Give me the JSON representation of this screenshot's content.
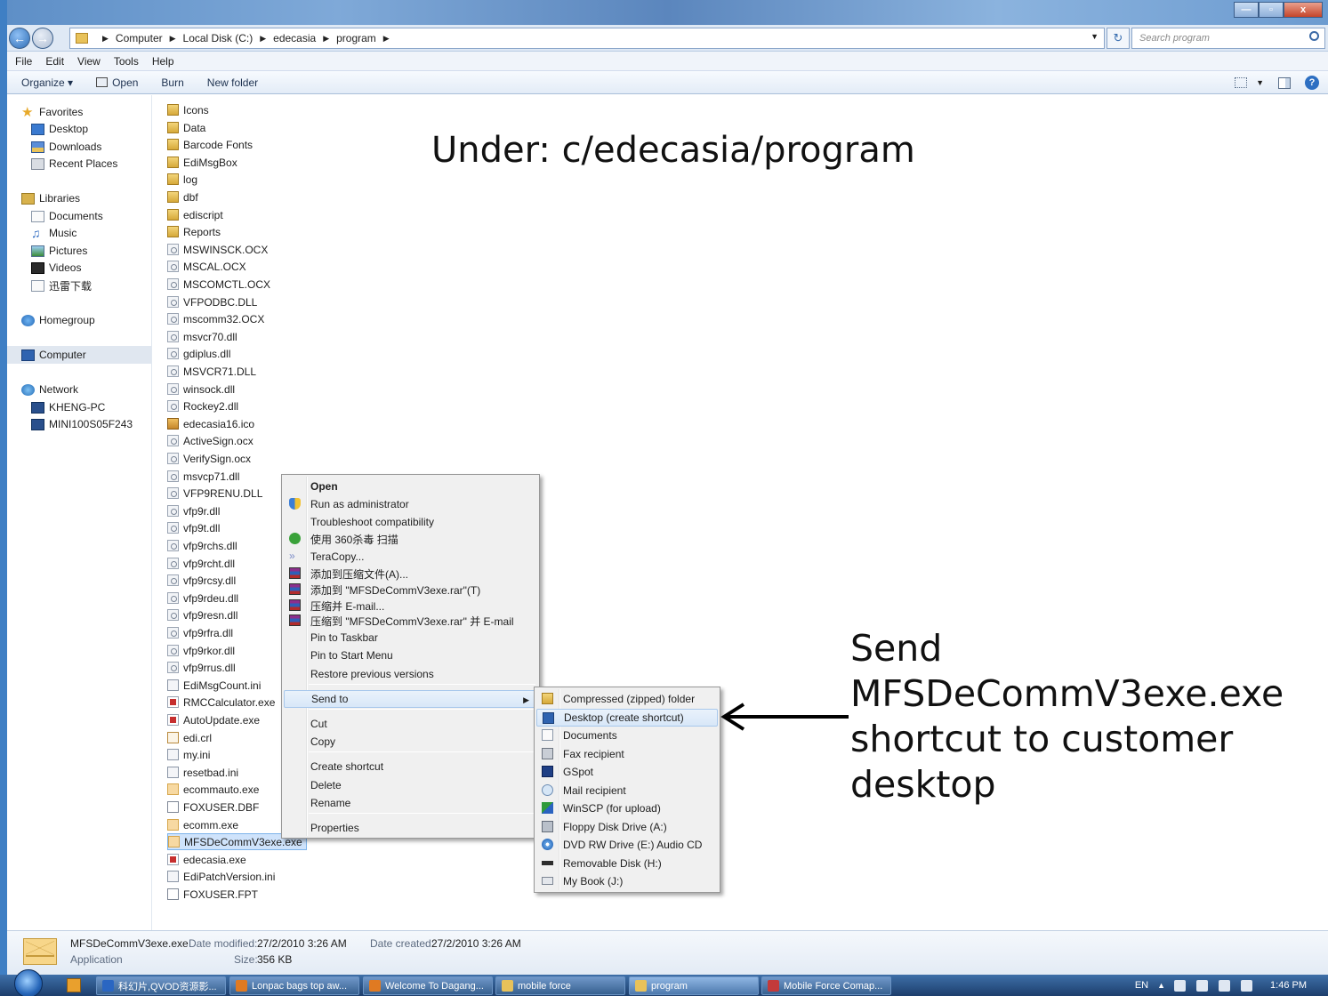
{
  "window": {
    "buttons": {
      "minimize": "—",
      "maximize": "▫",
      "close": "x"
    }
  },
  "address": {
    "crumbs": [
      "Computer",
      "Local Disk (C:)",
      "edecasia",
      "program"
    ],
    "search_placeholder": "Search program"
  },
  "menubar": [
    "File",
    "Edit",
    "View",
    "Tools",
    "Help"
  ],
  "toolbar": {
    "organize": "Organize ▾",
    "open": "Open",
    "burn": "Burn",
    "new_folder": "New folder"
  },
  "nav": {
    "favorites": "Favorites",
    "desktop": "Desktop",
    "downloads": "Downloads",
    "recent": "Recent Places",
    "libraries": "Libraries",
    "documents": "Documents",
    "music": "Music",
    "pictures": "Pictures",
    "videos": "Videos",
    "xunlei": "迅雷下载",
    "homegroup": "Homegroup",
    "computer": "Computer",
    "network": "Network",
    "kheng_pc": "KHENG-PC",
    "mini": "MINI100S05F243"
  },
  "files": [
    {
      "name": "Icons",
      "type": "folder"
    },
    {
      "name": "Data",
      "type": "folder"
    },
    {
      "name": "Barcode Fonts",
      "type": "folder"
    },
    {
      "name": "EdiMsgBox",
      "type": "folder"
    },
    {
      "name": "log",
      "type": "folder"
    },
    {
      "name": "dbf",
      "type": "folder"
    },
    {
      "name": "ediscript",
      "type": "folder"
    },
    {
      "name": "Reports",
      "type": "folder"
    },
    {
      "name": "MSWINSCK.OCX",
      "type": "dll"
    },
    {
      "name": "MSCAL.OCX",
      "type": "dll"
    },
    {
      "name": "MSCOMCTL.OCX",
      "type": "dll"
    },
    {
      "name": "VFPODBC.DLL",
      "type": "dll"
    },
    {
      "name": "mscomm32.OCX",
      "type": "dll"
    },
    {
      "name": "msvcr70.dll",
      "type": "dll"
    },
    {
      "name": "gdiplus.dll",
      "type": "dll"
    },
    {
      "name": "MSVCR71.DLL",
      "type": "dll"
    },
    {
      "name": "winsock.dll",
      "type": "dll"
    },
    {
      "name": "Rockey2.dll",
      "type": "dll"
    },
    {
      "name": "edecasia16.ico",
      "type": "ico"
    },
    {
      "name": "ActiveSign.ocx",
      "type": "dll"
    },
    {
      "name": "VerifySign.ocx",
      "type": "dll"
    },
    {
      "name": "msvcp71.dll",
      "type": "dll"
    },
    {
      "name": "VFP9RENU.DLL",
      "type": "dll"
    },
    {
      "name": "vfp9r.dll",
      "type": "dll"
    },
    {
      "name": "vfp9t.dll",
      "type": "dll"
    },
    {
      "name": "vfp9rchs.dll",
      "type": "dll"
    },
    {
      "name": "vfp9rcht.dll",
      "type": "dll"
    },
    {
      "name": "vfp9rcsy.dll",
      "type": "dll"
    },
    {
      "name": "vfp9rdeu.dll",
      "type": "dll"
    },
    {
      "name": "vfp9resn.dll",
      "type": "dll"
    },
    {
      "name": "vfp9rfra.dll",
      "type": "dll"
    },
    {
      "name": "vfp9rkor.dll",
      "type": "dll"
    },
    {
      "name": "vfp9rrus.dll",
      "type": "dll"
    },
    {
      "name": "EdiMsgCount.ini",
      "type": "ini"
    },
    {
      "name": "RMCCalculator.exe",
      "type": "exe"
    },
    {
      "name": "AutoUpdate.exe",
      "type": "exe"
    },
    {
      "name": "edi.crl",
      "type": "crl"
    },
    {
      "name": "my.ini",
      "type": "ini"
    },
    {
      "name": "resetbad.ini",
      "type": "ini"
    },
    {
      "name": "ecommauto.exe",
      "type": "app"
    },
    {
      "name": "FOXUSER.DBF",
      "type": "blank"
    },
    {
      "name": "ecomm.exe",
      "type": "app"
    },
    {
      "name": "MFSDeCommV3exe.exe",
      "type": "app",
      "selected": true
    },
    {
      "name": "edecasia.exe",
      "type": "exe"
    },
    {
      "name": "EdiPatchVersion.ini",
      "type": "ini"
    },
    {
      "name": "FOXUSER.FPT",
      "type": "blank"
    }
  ],
  "annotations": {
    "title": "Under: c/edecasia/program",
    "send_lines": [
      "Send",
      "MFSDeCommV3exe.exe",
      "shortcut to customer",
      "desktop"
    ]
  },
  "context_menu": [
    {
      "label": "Open",
      "bold": true,
      "icon": ""
    },
    {
      "label": "Run as administrator",
      "icon": "shield-icon"
    },
    {
      "label": "Troubleshoot compatibility",
      "icon": ""
    },
    {
      "label": "使用 360杀毒 扫描",
      "icon": "360-icon"
    },
    {
      "label": "TeraCopy...",
      "icon": "teracopy-icon"
    },
    {
      "label": "添加到压缩文件(A)...",
      "icon": "winrar-icon"
    },
    {
      "label": "添加到 \"MFSDeCommV3exe.rar\"(T)",
      "icon": "winrar-icon"
    },
    {
      "label": "压缩并 E-mail...",
      "icon": "winrar-icon"
    },
    {
      "label": "压缩到 \"MFSDeCommV3exe.rar\" 并 E-mail",
      "icon": "winrar-icon"
    },
    {
      "label": "Pin to Taskbar",
      "icon": ""
    },
    {
      "label": "Pin to Start Menu",
      "icon": ""
    },
    {
      "label": "Restore previous versions",
      "icon": ""
    },
    {
      "label": "Send to",
      "icon": "",
      "submenu": true,
      "highlighted": true
    },
    {
      "label": "Cut",
      "icon": ""
    },
    {
      "label": "Copy",
      "icon": ""
    },
    {
      "label": "Create shortcut",
      "icon": ""
    },
    {
      "label": "Delete",
      "icon": ""
    },
    {
      "label": "Rename",
      "icon": ""
    },
    {
      "label": "Properties",
      "icon": ""
    }
  ],
  "send_to_menu": [
    {
      "label": "Compressed (zipped) folder",
      "icon": "zip-folder-icon"
    },
    {
      "label": "Desktop (create shortcut)",
      "icon": "desktop-icon",
      "highlighted": true
    },
    {
      "label": "Documents",
      "icon": "documents-icon"
    },
    {
      "label": "Fax recipient",
      "icon": "fax-icon"
    },
    {
      "label": "GSpot",
      "icon": "gspot-icon"
    },
    {
      "label": "Mail recipient",
      "icon": "mail-icon"
    },
    {
      "label": "WinSCP (for upload)",
      "icon": "winscp-icon"
    },
    {
      "label": "Floppy Disk Drive (A:)",
      "icon": "floppy-icon"
    },
    {
      "label": "DVD RW Drive (E:) Audio CD",
      "icon": "dvd-icon"
    },
    {
      "label": "Removable Disk (H:)",
      "icon": "removable-disk-icon"
    },
    {
      "label": "My Book (J:)",
      "icon": "drive-icon"
    }
  ],
  "details": {
    "filename": "MFSDeCommV3exe.exe",
    "type": "Application",
    "modified_label": "Date modified:",
    "modified": "27/2/2010 3:26 AM",
    "created_label": "Date created:",
    "created": "27/2/2010 3:26 AM",
    "size_label": "Size:",
    "size": "356 KB"
  },
  "taskbar": {
    "buttons": [
      {
        "label": "科幻片,QVOD资源影...",
        "icon_color": "#2a66c2"
      },
      {
        "label": "Lonpac bags top aw...",
        "icon_color": "#e07a22"
      },
      {
        "label": "Welcome To Dagang...",
        "icon_color": "#e07a22"
      },
      {
        "label": "mobile force",
        "icon_color": "#e8c25a"
      },
      {
        "label": "program",
        "icon_color": "#e8c25a",
        "active": true
      },
      {
        "label": "Mobile Force Comap...",
        "icon_color": "#c33a3a"
      }
    ],
    "language": "EN",
    "clock": "1:46 PM"
  }
}
